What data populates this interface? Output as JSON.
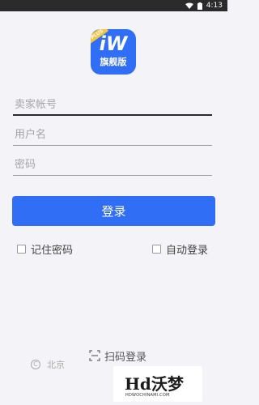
{
  "status_bar": {
    "time": "4:13"
  },
  "logo": {
    "mark": "iW",
    "text": "旗舰版",
    "badge": "PLUS"
  },
  "form": {
    "seller_account_placeholder": "卖家帐号",
    "username_placeholder": "用户名",
    "password_placeholder": "密码",
    "login_label": "登录",
    "remember_password_label": "记住密码",
    "auto_login_label": "自动登录"
  },
  "qr_login": {
    "label": "扫码登录"
  },
  "footer": {
    "text": "北京"
  },
  "watermark": {
    "title": "Hd沃梦",
    "subtitle": "HDWOCHINAMI.COM"
  },
  "colors": {
    "accent": "#2f6ef5",
    "background": "#f4f4f8",
    "status_bar": "#2b2b2b"
  }
}
